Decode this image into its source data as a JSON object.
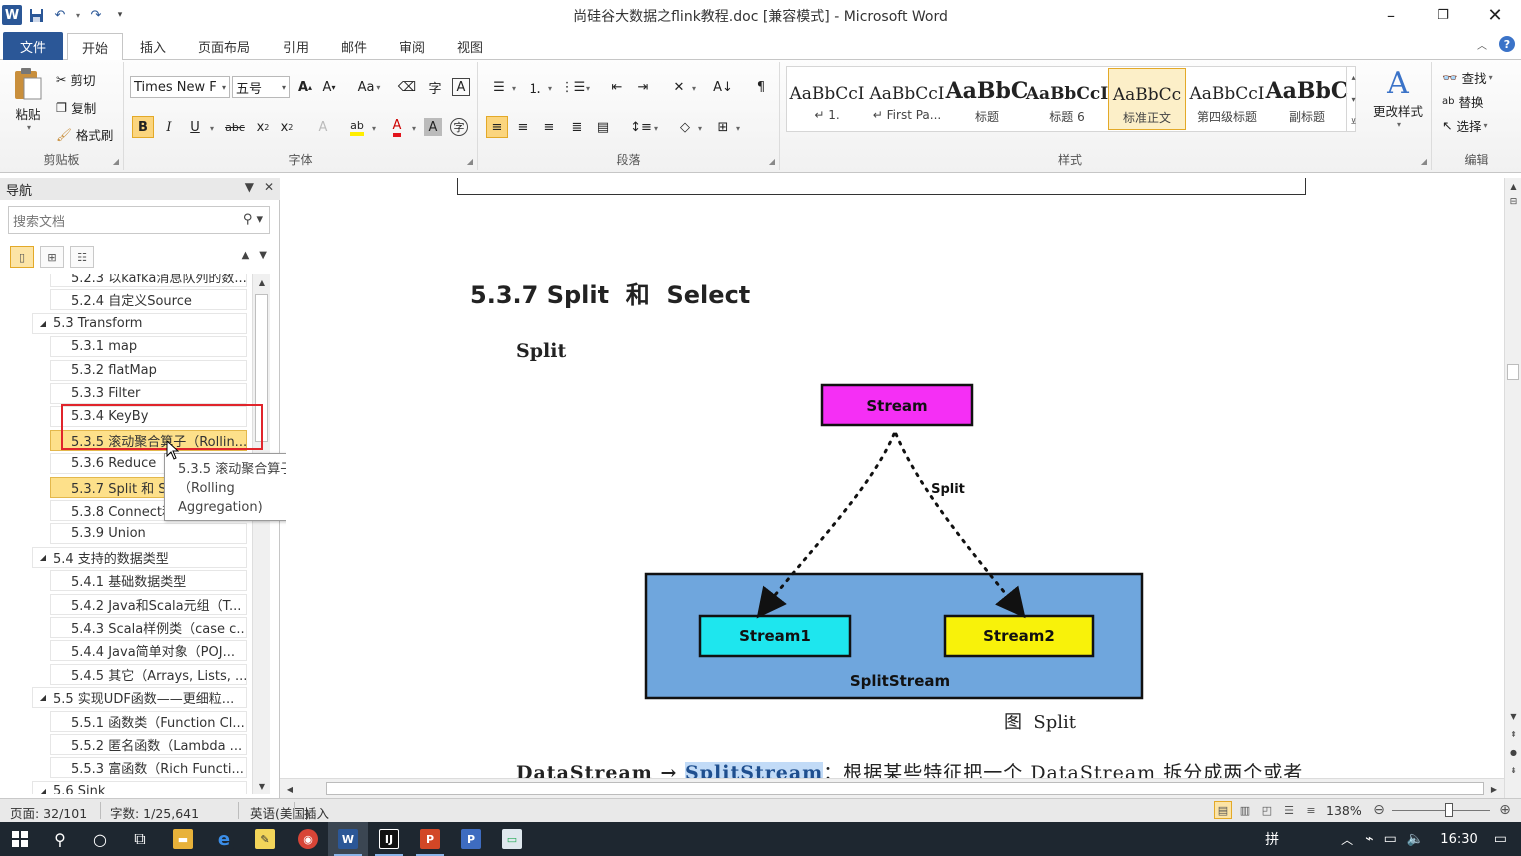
{
  "window": {
    "title": "尚硅谷大数据之flink教程.doc [兼容模式] - Microsoft Word"
  },
  "tabs": [
    "文件",
    "开始",
    "插入",
    "页面布局",
    "引用",
    "邮件",
    "审阅",
    "视图"
  ],
  "ribbon": {
    "clipboard": {
      "paste": "粘贴",
      "cut": "剪切",
      "copy": "复制",
      "format_painter": "格式刷",
      "label": "剪贴板"
    },
    "font": {
      "font_name": "Times New F",
      "font_size": "五号",
      "label": "字体"
    },
    "paragraph": {
      "label": "段落"
    },
    "styles": {
      "label": "样式",
      "change_styles": "更改样式",
      "items": [
        {
          "sample": "AaBbCcI",
          "name": "↵ 1."
        },
        {
          "sample": "AaBbCcI",
          "name": "↵ First Pa..."
        },
        {
          "sample": "AaBbC",
          "name": "标题"
        },
        {
          "sample": "AaBbCcI",
          "name": "标题 6"
        },
        {
          "sample": "AaBbCc",
          "name": "标准正文"
        },
        {
          "sample": "AaBbCcI",
          "name": "第四级标题"
        },
        {
          "sample": "AaBbC",
          "name": "副标题"
        }
      ]
    },
    "editing": {
      "find": "查找",
      "replace": "替换",
      "select": "选择",
      "label": "编辑"
    }
  },
  "nav": {
    "title": "导航",
    "search_placeholder": "搜索文档",
    "items": [
      {
        "level": 2,
        "text": "5.2.3 以kafka消息队列的数..."
      },
      {
        "level": 2,
        "text": "5.2.4 自定义Source"
      },
      {
        "level": 1,
        "text": "5.3 Transform"
      },
      {
        "level": 2,
        "text": "5.3.1 map"
      },
      {
        "level": 2,
        "text": "5.3.2 flatMap"
      },
      {
        "level": 2,
        "text": "5.3.3 Filter"
      },
      {
        "level": 2,
        "text": "5.3.4 KeyBy"
      },
      {
        "level": 2,
        "text": "5.3.5 滚动聚合算子（Rollin...",
        "highlight": true
      },
      {
        "level": 2,
        "text": "5.3.6 Reduce"
      },
      {
        "level": 2,
        "text": "5.3.7 Split 和 S",
        "highlight": true
      },
      {
        "level": 2,
        "text": "5.3.8 Connect和"
      },
      {
        "level": 2,
        "text": "5.3.9 Union"
      },
      {
        "level": 1,
        "text": "5.4 支持的数据类型"
      },
      {
        "level": 2,
        "text": "5.4.1 基础数据类型"
      },
      {
        "level": 2,
        "text": "5.4.2 Java和Scala元组（T..."
      },
      {
        "level": 2,
        "text": "5.4.3 Scala样例类（case c..."
      },
      {
        "level": 2,
        "text": "5.4.4 Java简单对象（POJ..."
      },
      {
        "level": 2,
        "text": "5.4.5 其它（Arrays, Lists, ..."
      },
      {
        "level": 1,
        "text": "5.5 实现UDF函数——更细粒..."
      },
      {
        "level": 2,
        "text": "5.5.1 函数类（Function Cl..."
      },
      {
        "level": 2,
        "text": "5.5.2 匿名函数（Lambda ..."
      },
      {
        "level": 2,
        "text": "5.5.3 富函数（Rich Functi..."
      },
      {
        "level": 1,
        "text": "5.6 Sink"
      }
    ],
    "tooltip": [
      "5.3.5 滚动聚合算子",
      "（Rolling",
      "Aggregation)"
    ]
  },
  "document": {
    "section_heading": "5.3.7 Split  和  Select",
    "sub_heading": "Split",
    "diagram": {
      "stream": "Stream",
      "split_label": "Split",
      "stream1": "Stream1",
      "stream2": "Stream2",
      "splitstream": "SplitStream"
    },
    "caption": "图  Split",
    "para_bold": "DataStream",
    "para_arrow": " → ",
    "para_selected": "SplitStream",
    "para_rest": "：根据某些特征把一个 DataStream 拆分成两个或者"
  },
  "status": {
    "page": "页面: 32/101",
    "words": "字数: 1/25,641",
    "language": "英语(美国)",
    "mode": "插入",
    "zoom": "138%"
  },
  "taskbar": {
    "time": "16:30",
    "ime": "拼"
  },
  "colors": {
    "stream_fill": "#f52ff5",
    "stream1_fill": "#1ee6ee",
    "stream2_fill": "#f8f20a",
    "splitstream_fill": "#6fa6dd",
    "word_blue": "#2b5797",
    "highlight": "#fde08a"
  }
}
